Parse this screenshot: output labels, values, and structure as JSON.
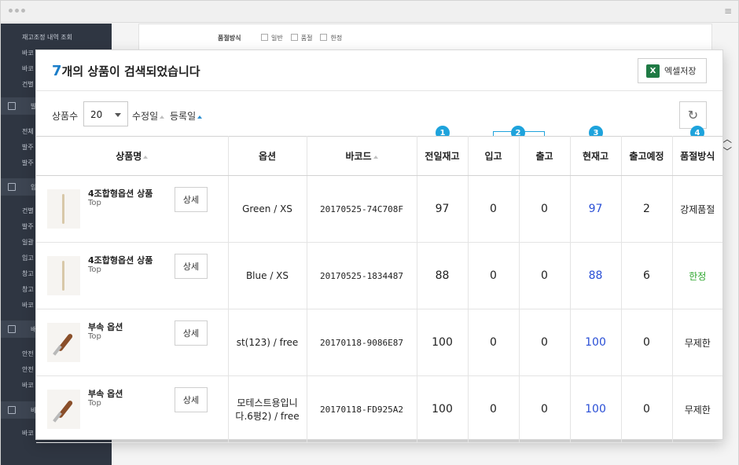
{
  "sidebar": {
    "items_top": [
      "재고조정 내역 조회",
      "바코",
      "바코",
      "건별"
    ],
    "section1": "발",
    "items_s1": [
      "전체",
      "발주",
      "발주"
    ],
    "section2": "입",
    "items_s2": [
      "건별",
      "발주",
      "일괄",
      "입고",
      "창고",
      "창고",
      "바코"
    ],
    "section3": "배",
    "items_s3": [
      "안전",
      "안전",
      "바코"
    ],
    "section4": "바",
    "items_s4": [
      "바코"
    ]
  },
  "bg": {
    "label": "품절방식",
    "options": [
      "일반",
      "품절",
      "한정"
    ]
  },
  "modal": {
    "count": "7",
    "count_suffix": "개의 상품이 검색되었습니다",
    "excel_label": "엑셀저장",
    "excel_icon": "excel-icon",
    "per_page_label": "상품수",
    "per_page_value": "20",
    "sort_modified": "수정일",
    "sort_registered": "등록일"
  },
  "badges": [
    "1",
    "2",
    "3",
    "4"
  ],
  "table": {
    "headers": [
      "상품명",
      "옵션",
      "바코드",
      "전일재고",
      "입고",
      "출고",
      "현재고",
      "출고예정",
      "품절방식"
    ],
    "detail_label": "상세",
    "rows": [
      {
        "name": "4조합형옵션 상품",
        "brand": "Top",
        "option": "Green / XS",
        "barcode": "20170525-74C708F",
        "prev": "97",
        "in": "0",
        "out": "0",
        "current": "97",
        "scheduled": "2",
        "soldout": "강제품절"
      },
      {
        "name": "4조합형옵션 상품",
        "brand": "Top",
        "option": "Blue / XS",
        "barcode": "20170525-1834487",
        "prev": "88",
        "in": "0",
        "out": "0",
        "current": "88",
        "scheduled": "6",
        "soldout": "한정"
      },
      {
        "name": "부속 옵션",
        "brand": "Top",
        "option": "st(123) / free",
        "barcode": "20170118-9086E87",
        "prev": "100",
        "in": "0",
        "out": "0",
        "current": "100",
        "scheduled": "0",
        "soldout": "무제한"
      },
      {
        "name": "부속 옵션",
        "brand": "Top",
        "option": "모테스트용입니다.6평2) / free",
        "barcode": "20170118-FD925A2",
        "prev": "100",
        "in": "0",
        "out": "0",
        "current": "100",
        "scheduled": "0",
        "soldout": "무제한"
      }
    ]
  },
  "colors": {
    "accent": "#1ea3dc",
    "current_stock": "#2a4fd6",
    "limited": "#2aa52a",
    "sidebar": "#2f3642"
  }
}
